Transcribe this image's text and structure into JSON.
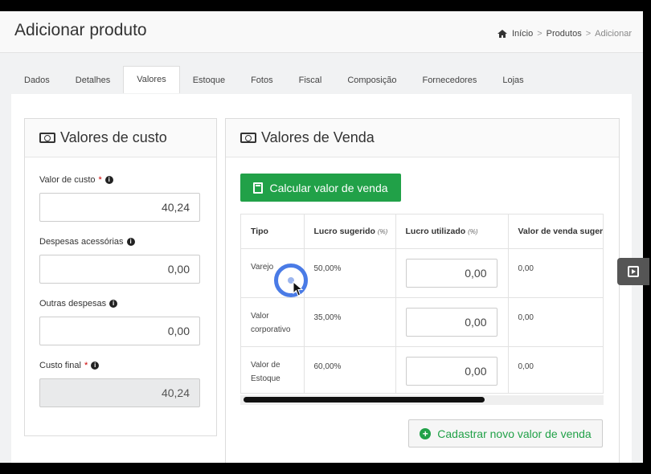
{
  "header": {
    "title": "Adicionar produto",
    "breadcrumb": [
      "Início",
      "Produtos",
      "Adicionar"
    ],
    "separator": ">"
  },
  "tabs": [
    {
      "label": "Dados",
      "active": false
    },
    {
      "label": "Detalhes",
      "active": false
    },
    {
      "label": "Valores",
      "active": true
    },
    {
      "label": "Estoque",
      "active": false
    },
    {
      "label": "Fotos",
      "active": false
    },
    {
      "label": "Fiscal",
      "active": false
    },
    {
      "label": "Composição",
      "active": false
    },
    {
      "label": "Fornecedores",
      "active": false
    },
    {
      "label": "Lojas",
      "active": false
    }
  ],
  "custo": {
    "title": "Valores de custo",
    "fields": [
      {
        "label": "Valor de custo",
        "required": "*",
        "value": "40,24",
        "disabled": false
      },
      {
        "label": "Despesas acessórias",
        "required": "",
        "value": "0,00",
        "disabled": false
      },
      {
        "label": "Outras despesas",
        "required": "",
        "value": "0,00",
        "disabled": false
      },
      {
        "label": "Custo final",
        "required": "*",
        "value": "40,24",
        "disabled": true
      }
    ]
  },
  "venda": {
    "title": "Valores de Venda",
    "calc_button": "Calcular valor de venda",
    "columns": {
      "tipo": "Tipo",
      "lucro_sugerido": "Lucro sugerido",
      "lucro_sugerido_unit": "(%)",
      "lucro_utilizado": "Lucro utilizado",
      "lucro_utilizado_unit": "(%)",
      "valor_venda": "Valor de venda sugeri"
    },
    "rows": [
      {
        "tipo": "Varejo",
        "lucro_sugerido": "50,00%",
        "lucro_utilizado": "0,00",
        "valor_venda": "0,00"
      },
      {
        "tipo": "Valor corporativo",
        "lucro_sugerido": "35,00%",
        "lucro_utilizado": "0,00",
        "valor_venda": "0,00"
      },
      {
        "tipo": "Valor de Estoque",
        "lucro_sugerido": "60,00%",
        "lucro_utilizado": "0,00",
        "valor_venda": "0,00"
      }
    ],
    "add_button": "Cadastrar novo valor de venda"
  },
  "colors": {
    "accent_green": "#21a148",
    "cursor_blue": "#4a7be6"
  },
  "icons": [
    "home-icon",
    "money-icon",
    "info-icon",
    "calculator-icon",
    "plus-circle-icon",
    "play-icon"
  ]
}
